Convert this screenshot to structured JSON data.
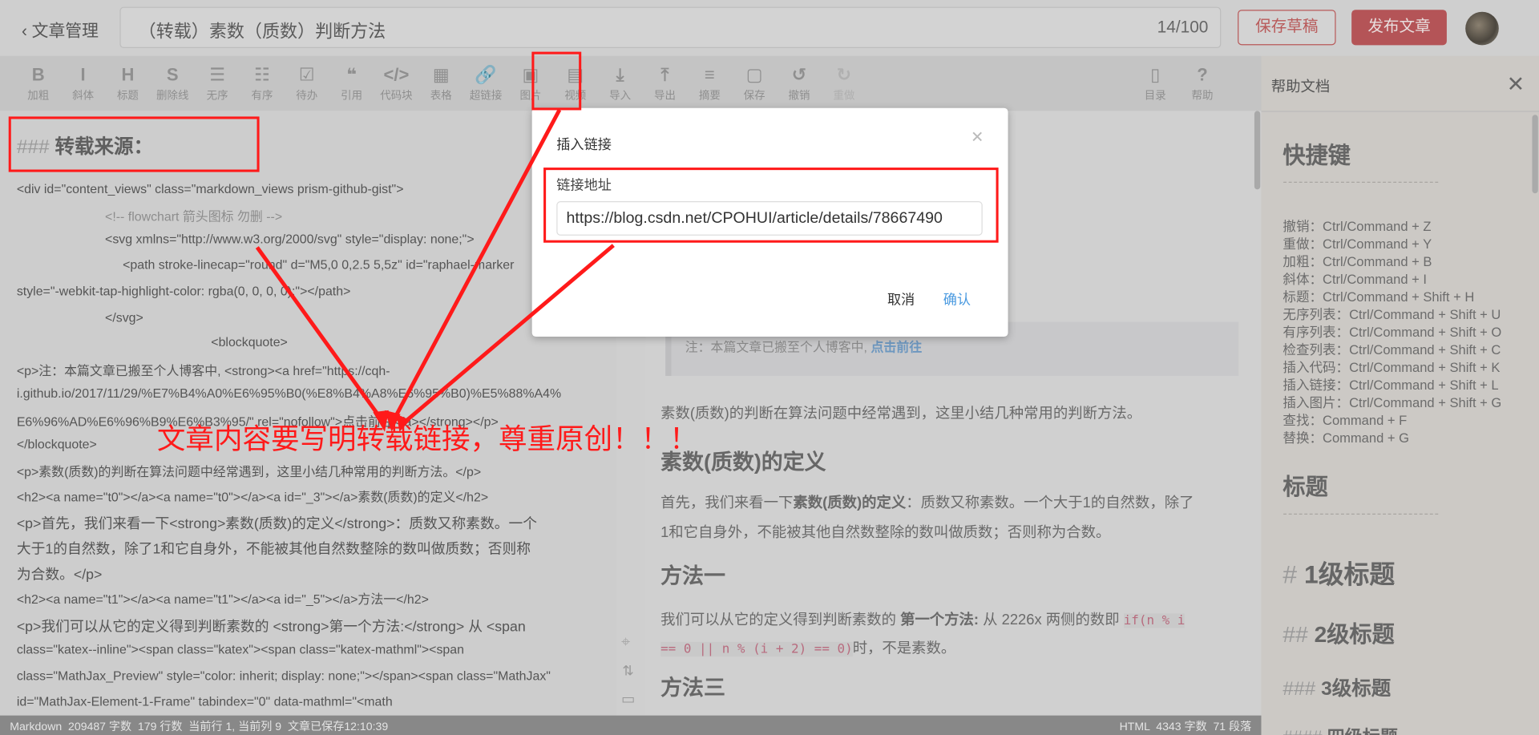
{
  "header": {
    "back_label": "文章管理",
    "title": "（转载）素数（质数）判断方法",
    "title_count": "14/100",
    "save_draft": "保存草稿",
    "publish": "发布文章"
  },
  "toolbar": [
    {
      "icon": "bold-icon",
      "glyph": "B",
      "label": "加粗"
    },
    {
      "icon": "italic-icon",
      "glyph": "I",
      "label": "斜体"
    },
    {
      "icon": "heading-icon",
      "glyph": "H",
      "label": "标题"
    },
    {
      "icon": "strikethrough-icon",
      "glyph": "S",
      "label": "删除线"
    },
    {
      "icon": "unordered-list-icon",
      "glyph": "☰",
      "label": "无序"
    },
    {
      "icon": "ordered-list-icon",
      "glyph": "☷",
      "label": "有序"
    },
    {
      "icon": "todo-icon",
      "glyph": "☑",
      "label": "待办"
    },
    {
      "icon": "quote-icon",
      "glyph": "❝",
      "label": "引用"
    },
    {
      "icon": "code-block-icon",
      "glyph": "</>",
      "label": "代码块"
    },
    {
      "icon": "table-icon",
      "glyph": "▦",
      "label": "表格"
    },
    {
      "icon": "link-icon",
      "glyph": "🔗",
      "label": "超链接"
    },
    {
      "icon": "image-icon",
      "glyph": "▣",
      "label": "图片"
    },
    {
      "icon": "video-icon",
      "glyph": "▤",
      "label": "视频"
    },
    {
      "icon": "import-icon",
      "glyph": "⤓",
      "label": "导入"
    },
    {
      "icon": "export-icon",
      "glyph": "⤒",
      "label": "导出"
    },
    {
      "icon": "summary-icon",
      "glyph": "≡",
      "label": "摘要"
    },
    {
      "icon": "save-icon",
      "glyph": "▢",
      "label": "保存"
    },
    {
      "icon": "undo-icon",
      "glyph": "↺",
      "label": "撤销"
    },
    {
      "icon": "redo-icon",
      "glyph": "↻",
      "label": "重做"
    }
  ],
  "toolbar_right": [
    {
      "icon": "toc-icon",
      "glyph": "▯",
      "label": "目录"
    },
    {
      "icon": "help-icon",
      "glyph": "?",
      "label": "帮助"
    }
  ],
  "editor": {
    "heading_marker": "###",
    "heading": "转载来源：",
    "lines": [
      "<div id=\"content_views\" class=\"markdown_views prism-github-gist\">",
      "<!-- flowchart 箭头图标 勿删 -->",
      "<svg xmlns=\"http://www.w3.org/2000/svg\" style=\"display: none;\">",
      "<path stroke-linecap=\"round\" d=\"M5,0 0,2.5 5,5z\" id=\"raphael-marker",
      "style=\"-webkit-tap-highlight-color: rgba(0, 0, 0, 0);\"></path>",
      "</svg>",
      "<blockquote>",
      "<p>注：本篇文章已搬至个人博客中, <strong><a href=\"https://cqh-",
      "i.github.io/2017/11/29/%E7%B4%A0%E6%95%B0(%E8%B4%A8%E6%95%B0)%E5%88%A4%",
      "E6%96%AD%E6%96%B9%E6%B3%95/\" rel=\"nofollow\">点击前往</a></strong></p>",
      "</blockquote>",
      "<p>素数(质数)的判断在算法问题中经常遇到，这里小结几种常用的判断方法。</p>",
      "<h2><a name=\"t0\"></a><a name=\"t0\"></a><a id=\"_3\"></a>素数(质数)的定义</h2>",
      "<p>首先，我们来看一下<strong>素数(质数)的定义</strong>：质数又称素数。一个",
      "大于1的自然数，除了1和它自身外，不能被其他自然数整除的数叫做质数；否则称",
      "为合数。</p>",
      "<h2><a name=\"t1\"></a><a name=\"t1\"></a><a id=\"_5\"></a>方法一</h2>",
      "<p>我们可以从它的定义得到判断素数的 <strong>第一个方法:</strong> 从 <span",
      "class=\"katex--inline\"><span class=\"katex\"><span class=\"katex-mathml\"><span",
      "class=\"MathJax_Preview\" style=\"color: inherit; display: none;\"></span><span class=\"MathJax\"",
      "id=\"MathJax-Element-1-Frame\" tabindex=\"0\" data-mathml=\"<math"
    ]
  },
  "preview": {
    "quote_text": "注：本篇文章已搬至个人博客中,",
    "quote_link": "点击前往",
    "p1": "素数(质数)的判断在算法问题中经常遇到，这里小结几种常用的判断方法。",
    "h_def": "素数(质数)的定义",
    "p2_a": "首先，我们来看一下",
    "p2_b": "素数(质数)的定义",
    "p2_c": "：质数又称素数。一个大于1的自然数，除了",
    "p2_d": "1和它自身外，不能被其他自然数整除的数叫做质数；否则称为合数。",
    "h_m1": "方法一",
    "p3_a": "我们可以从它的定义得到判断素数的 ",
    "p3_b": "第一个方法:",
    "p3_c": " 从 2226x 两侧的数即 ",
    "p3_code1": "if(n % i",
    "p3_code2": "== 0 || n % (i + 2) == 0)",
    "p3_d": "时，不是素数。",
    "h_m3": "方法三"
  },
  "help": {
    "title": "帮助文档",
    "section1": "快捷键",
    "divider": "------------------------------",
    "shortcuts": [
      "撤销：Ctrl/Command + Z",
      "重做：Ctrl/Command + Y",
      "加粗：Ctrl/Command + B",
      "斜体：Ctrl/Command + I",
      "标题：Ctrl/Command + Shift + H",
      "无序列表：Ctrl/Command + Shift + U",
      "有序列表：Ctrl/Command + Shift + O",
      "检查列表：Ctrl/Command + Shift + C",
      "插入代码：Ctrl/Command + Shift + K",
      "插入链接：Ctrl/Command + Shift + L",
      "插入图片：Ctrl/Command + Shift + G",
      "查找：Command + F",
      "替换：Command + G"
    ],
    "section2": "标题",
    "h1_marker": "#",
    "h1": "1级标题",
    "h2_marker": "##",
    "h2": "2级标题",
    "h3_marker": "###",
    "h3": "3级标题",
    "h4_marker": "####",
    "h4": "四级标题"
  },
  "status": {
    "left": "Markdown  209487 字数  179 行数  当前行 1, 当前列 9  文章已保存12:10:39",
    "right": "HTML  4343 字数  71 段落"
  },
  "modal": {
    "title": "插入链接",
    "label": "链接地址",
    "url": "https://blog.csdn.net/CPOHUI/article/details/78667490",
    "cancel": "取消",
    "confirm": "确认"
  },
  "annotation": {
    "text": "文章内容要写明转载链接，尊重原创！！！",
    "color": "#ff1a1a"
  }
}
